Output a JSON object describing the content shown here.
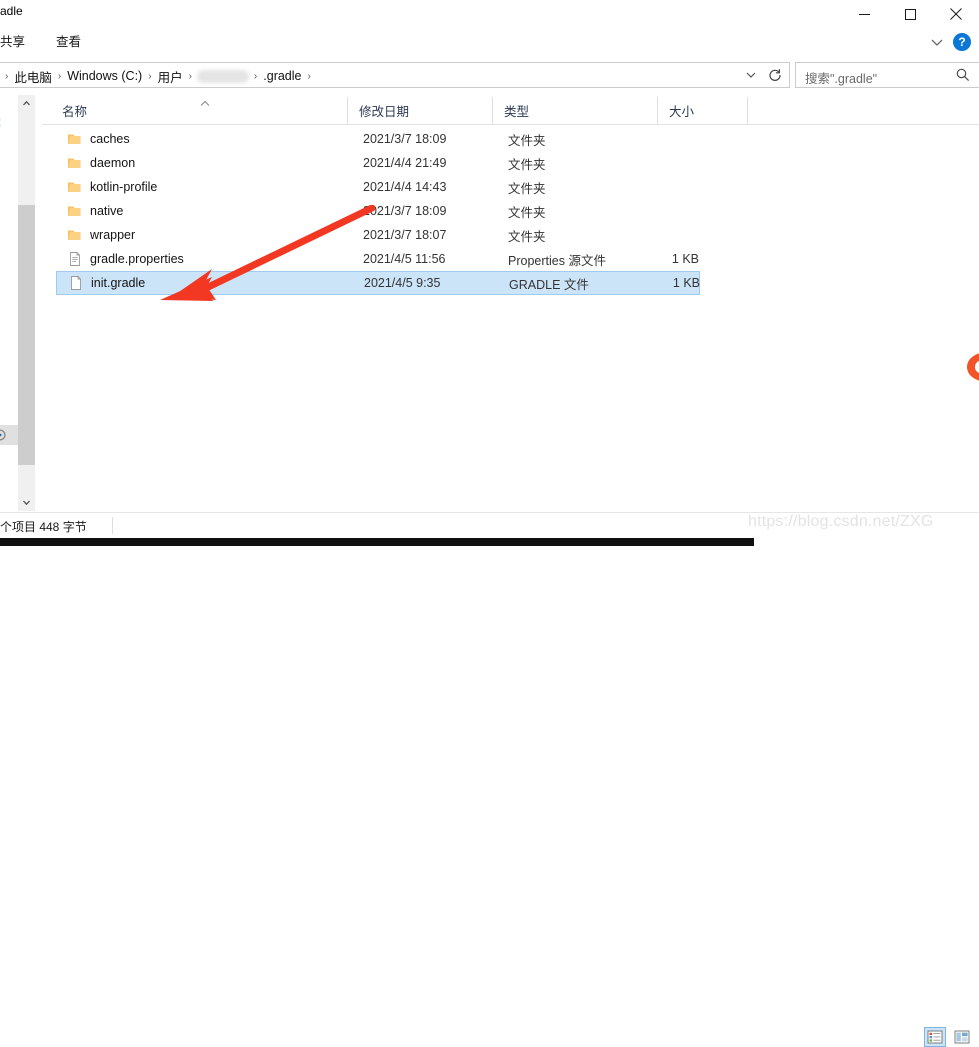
{
  "window": {
    "title": "adle",
    "controls": {
      "minimize": "minimize-button",
      "maximize": "maximize-button",
      "close": "close-button"
    }
  },
  "ribbon": {
    "tabs": [
      {
        "label": "共享",
        "name": "tab-share"
      },
      {
        "label": "查看",
        "name": "tab-view"
      }
    ],
    "help_label": "?",
    "chevron": "chevron-down-icon"
  },
  "address": {
    "crumbs": [
      {
        "label": "此电脑",
        "type": "text"
      },
      {
        "label": "Windows (C:)",
        "type": "text"
      },
      {
        "label": "用户",
        "type": "text"
      },
      {
        "label": "",
        "type": "blurred"
      },
      {
        "label": ".gradle",
        "type": "text"
      }
    ],
    "separator": "›",
    "dropdown_icon": "chevron-down-icon",
    "refresh_icon": "refresh-icon"
  },
  "search": {
    "placeholder": "搜索\".gradle\"",
    "icon": "search-icon"
  },
  "columns": [
    {
      "label": "名称",
      "name": "column-header-name"
    },
    {
      "label": "修改日期",
      "name": "column-header-date"
    },
    {
      "label": "类型",
      "name": "column-header-type"
    },
    {
      "label": "大小",
      "name": "column-header-size"
    }
  ],
  "sort_indicator": "⌃",
  "files": [
    {
      "name": "caches",
      "date": "2021/3/7 18:09",
      "type": "文件夹",
      "size": "",
      "icon": "folder-icon",
      "selected": false
    },
    {
      "name": "daemon",
      "date": "2021/4/4 21:49",
      "type": "文件夹",
      "size": "",
      "icon": "folder-icon",
      "selected": false
    },
    {
      "name": "kotlin-profile",
      "date": "2021/4/4 14:43",
      "type": "文件夹",
      "size": "",
      "icon": "folder-icon",
      "selected": false
    },
    {
      "name": "native",
      "date": "2021/3/7 18:09",
      "type": "文件夹",
      "size": "",
      "icon": "folder-icon",
      "selected": false
    },
    {
      "name": "wrapper",
      "date": "2021/3/7 18:07",
      "type": "文件夹",
      "size": "",
      "icon": "folder-icon",
      "selected": false
    },
    {
      "name": "gradle.properties",
      "date": "2021/4/5 11:56",
      "type": "Properties 源文件",
      "size": "1 KB",
      "icon": "text-file-icon",
      "selected": false
    },
    {
      "name": "init.gradle",
      "date": "2021/4/5 9:35",
      "type": "GRADLE 文件",
      "size": "1 KB",
      "icon": "blank-file-icon",
      "selected": true
    }
  ],
  "status": {
    "text": "个项目  448 字节"
  },
  "watermark": {
    "text": "https://blog.csdn.net/ZXG"
  },
  "view_buttons": [
    {
      "name": "details-view-button",
      "active": true
    },
    {
      "name": "large-icons-view-button",
      "active": false
    }
  ],
  "annotation": {
    "arrow_color": "#f23722",
    "description": "red-arrow-pointing-to-init-gradle"
  },
  "colors": {
    "selection": "#cce4f7",
    "selection_border": "#9fcbf0",
    "folder": "#ffce6b",
    "accent": "#0b77d6",
    "arrow_red": "#f23722"
  }
}
